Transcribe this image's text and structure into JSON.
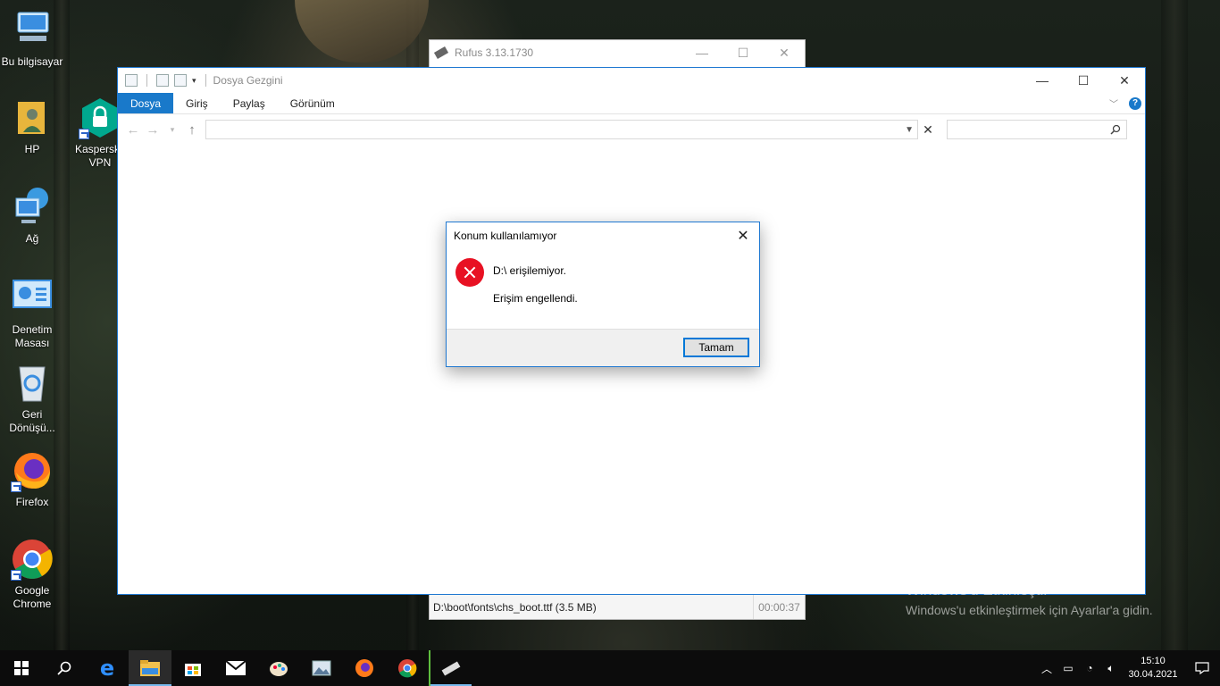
{
  "desktop": {
    "icons": [
      {
        "label": "Bu bilgisayar",
        "icon": "computer-icon"
      },
      {
        "label": "HP",
        "icon": "user-folder-icon"
      },
      {
        "label": "Kaspersky VPN",
        "icon": "kaspersky-vpn-icon"
      },
      {
        "label": "Ağ",
        "icon": "network-icon"
      },
      {
        "label": "Denetim Masası",
        "icon": "control-panel-icon"
      },
      {
        "label": "Geri Dönüşü...",
        "icon": "recycle-bin-icon"
      },
      {
        "label": "Firefox",
        "icon": "firefox-icon"
      },
      {
        "label": "Google Chrome",
        "icon": "chrome-icon"
      }
    ]
  },
  "rufus": {
    "title": "Rufus 3.13.1730",
    "status_path": "D:\\boot\\fonts\\chs_boot.ttf (3.5 MB)",
    "status_time": "00:00:37"
  },
  "explorer": {
    "title": "Dosya Gezgini",
    "tabs": [
      "Dosya",
      "Giriş",
      "Paylaş",
      "Görünüm"
    ],
    "active_tab": "Dosya"
  },
  "dialog": {
    "title": "Konum kullanılamıyor",
    "message": "D:\\ erişilemiyor.",
    "detail": "Erişim engellendi.",
    "ok_label": "Tamam"
  },
  "watermark": {
    "title": "Windows'u Etkinleştir",
    "subtitle": "Windows'u etkinleştirmek için Ayarlar'a gidin."
  },
  "taskbar": {
    "apps": [
      "start-icon",
      "search-icon",
      "edge-icon",
      "file-explorer-icon",
      "store-icon",
      "mail-icon",
      "paint-icon",
      "photos-icon",
      "firefox-icon",
      "chrome-icon",
      "rufus-icon"
    ],
    "time": "15:10",
    "date": "30.04.2021"
  },
  "colors": {
    "accent": "#1979ca",
    "error": "#e81123",
    "button_border": "#0078d7"
  }
}
